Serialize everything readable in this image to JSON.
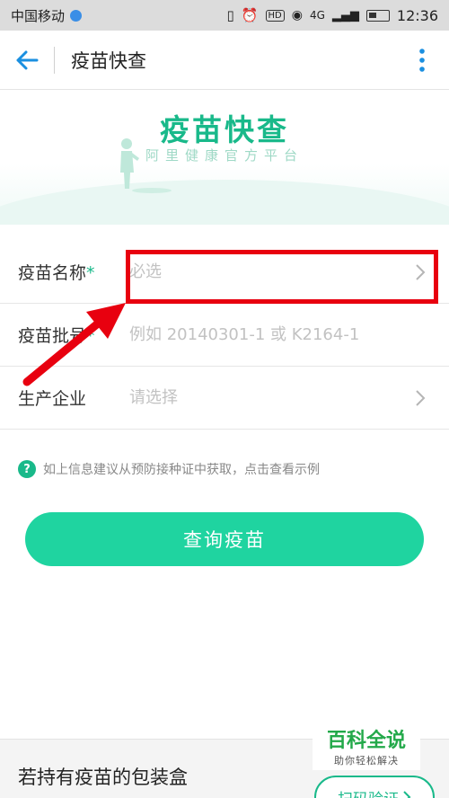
{
  "status_bar": {
    "carrier": "中国移动",
    "hd_badge": "HD",
    "signal_label": "4G",
    "time": "12:36"
  },
  "nav": {
    "title": "疫苗快查",
    "back_icon": "arrow-left-icon",
    "more_icon": "more-vertical-icon"
  },
  "banner": {
    "title": "疫苗快查",
    "subtitle": "阿里健康官方平台"
  },
  "form": {
    "name_label": "疫苗名称",
    "name_required_mark": "*",
    "name_placeholder": "必选",
    "batch_label": "疫苗批号",
    "batch_required_mark": "*",
    "batch_placeholder": "例如 20140301-1 或 K2164-1",
    "company_label": "生产企业",
    "company_placeholder": "请选择"
  },
  "hint": {
    "icon_text": "?",
    "text": "如上信息建议从预防接种证中获取，点击查看示例"
  },
  "query_button": "查询疫苗",
  "bottom": {
    "text": "若持有疫苗的包装盒",
    "scan_button": "扫码验证"
  },
  "watermark": {
    "big": "百科全说",
    "small": "助你轻松解决"
  },
  "colors": {
    "accent": "#19b98a",
    "button": "#1fd4a0",
    "highlight": "#e8000f"
  }
}
